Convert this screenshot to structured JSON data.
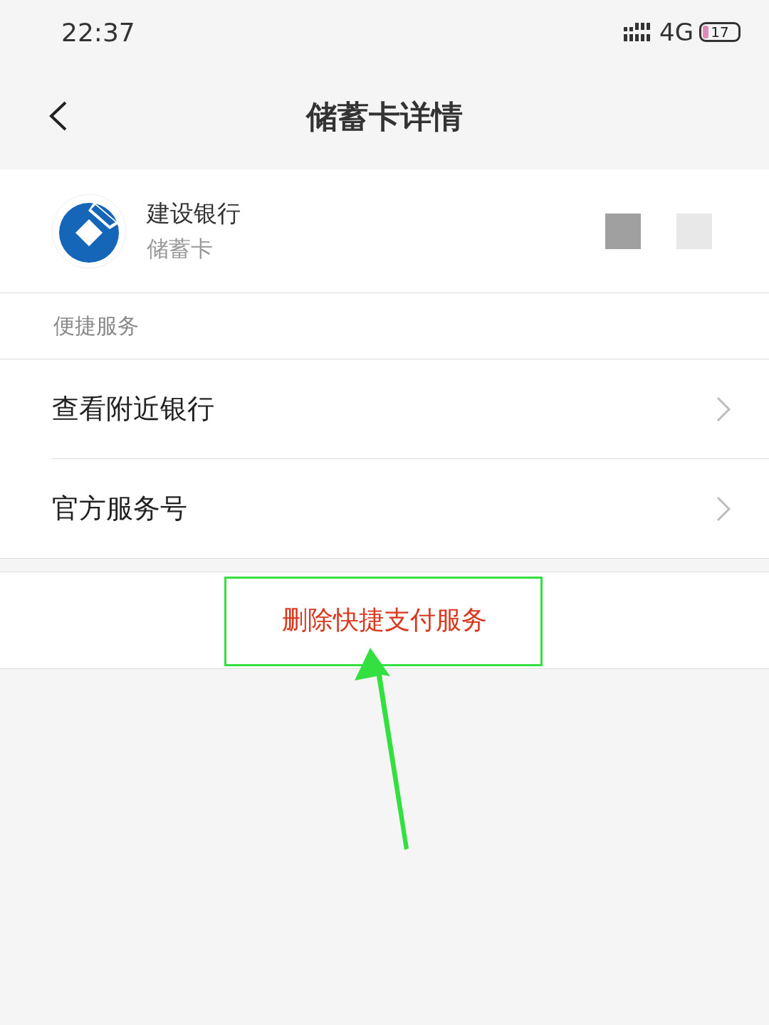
{
  "status_bar": {
    "time": "22:37",
    "network": "4G",
    "battery": "17"
  },
  "header": {
    "title": "储蓄卡详情"
  },
  "card": {
    "bank": "建设银行",
    "type": "储蓄卡"
  },
  "section": {
    "label": "便捷服务",
    "items": [
      {
        "label": "查看附近银行"
      },
      {
        "label": "官方服务号"
      }
    ]
  },
  "action": {
    "label": "删除快捷支付服务"
  }
}
